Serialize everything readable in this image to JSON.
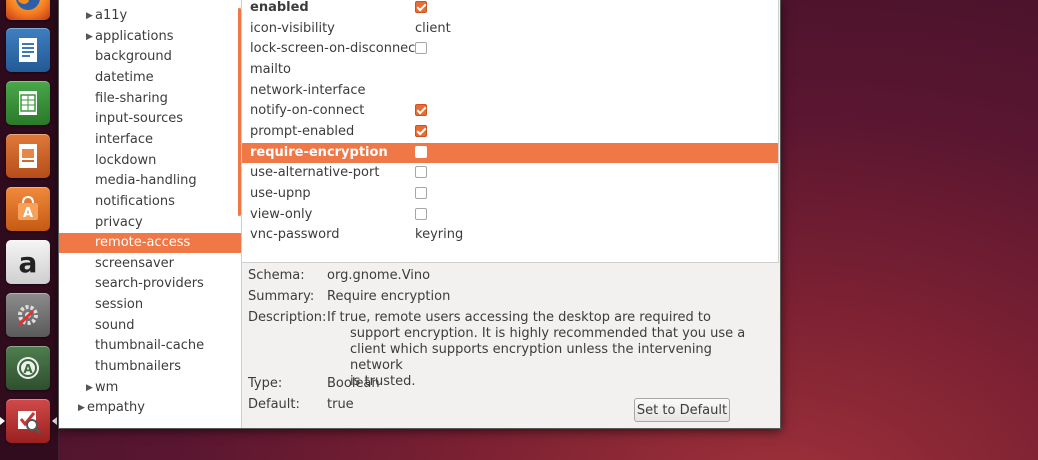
{
  "launcher": {
    "items": [
      {
        "name": "firefox-icon"
      },
      {
        "name": "libreoffice-writer-icon"
      },
      {
        "name": "libreoffice-calc-icon"
      },
      {
        "name": "libreoffice-impress-icon"
      },
      {
        "name": "ubuntu-software-center-icon"
      },
      {
        "name": "amazon-icon",
        "glyph": "a"
      },
      {
        "name": "system-settings-icon"
      },
      {
        "name": "software-updater-icon"
      },
      {
        "name": "dconf-editor-icon"
      }
    ]
  },
  "tree": {
    "items": [
      {
        "label": "a11y",
        "expandable": true
      },
      {
        "label": "applications",
        "expandable": true
      },
      {
        "label": "background"
      },
      {
        "label": "datetime"
      },
      {
        "label": "file-sharing"
      },
      {
        "label": "input-sources"
      },
      {
        "label": "interface"
      },
      {
        "label": "lockdown"
      },
      {
        "label": "media-handling"
      },
      {
        "label": "notifications"
      },
      {
        "label": "privacy"
      },
      {
        "label": "remote-access",
        "selected": true
      },
      {
        "label": "screensaver"
      },
      {
        "label": "search-providers"
      },
      {
        "label": "session"
      },
      {
        "label": "sound"
      },
      {
        "label": "thumbnail-cache"
      },
      {
        "label": "thumbnailers"
      },
      {
        "label": "wm",
        "expandable": true
      },
      {
        "label": "empathy",
        "expandable": true,
        "level": 0
      }
    ]
  },
  "keys": [
    {
      "name": "enabled",
      "type": "bool",
      "checked": true,
      "bold": true
    },
    {
      "name": "icon-visibility",
      "type": "text",
      "value": "client"
    },
    {
      "name": "lock-screen-on-disconnect",
      "type": "bool",
      "checked": false
    },
    {
      "name": "mailto",
      "type": "text",
      "value": ""
    },
    {
      "name": "network-interface",
      "type": "text",
      "value": ""
    },
    {
      "name": "notify-on-connect",
      "type": "bool",
      "checked": true
    },
    {
      "name": "prompt-enabled",
      "type": "bool",
      "checked": true
    },
    {
      "name": "require-encryption",
      "type": "bool",
      "checked": false,
      "selected": true
    },
    {
      "name": "use-alternative-port",
      "type": "bool",
      "checked": false
    },
    {
      "name": "use-upnp",
      "type": "bool",
      "checked": false
    },
    {
      "name": "view-only",
      "type": "bool",
      "checked": false
    },
    {
      "name": "vnc-password",
      "type": "text",
      "value": "keyring"
    }
  ],
  "details": {
    "schema_label": "Schema:",
    "schema_value": "org.gnome.Vino",
    "summary_label": "Summary:",
    "summary_value": "Require encryption",
    "description_label": "Description:",
    "description_lines": [
      "If true, remote users accessing the desktop are required to",
      "support encryption. It is highly recommended that you use a",
      "client which supports encryption unless the intervening network",
      "is trusted."
    ],
    "type_label": "Type:",
    "type_value": "Boolean",
    "default_label": "Default:",
    "default_value": "true"
  },
  "buttons": {
    "set_default": "Set to Default"
  },
  "colors": {
    "accent": "#f07746",
    "checkbox_checked": "#ea6c33",
    "launcher_bg": "#2a0a19"
  }
}
